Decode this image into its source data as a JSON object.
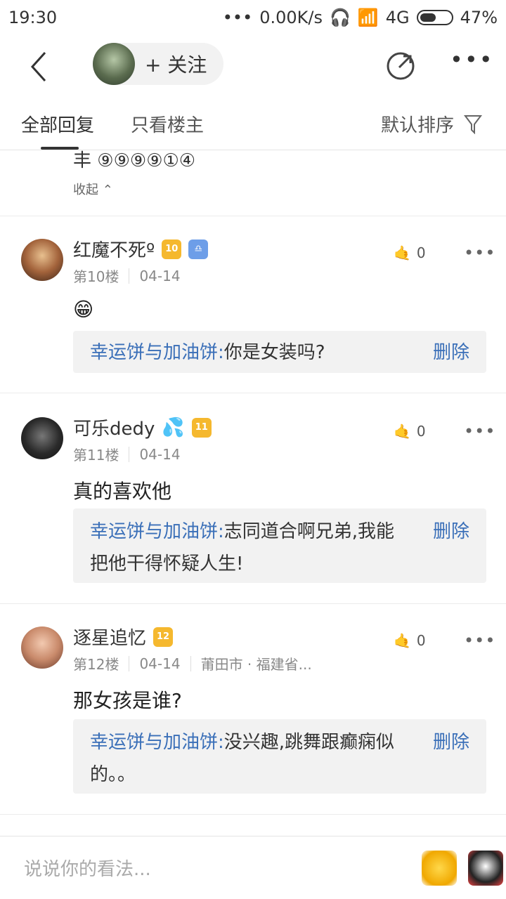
{
  "status": {
    "time": "19:30",
    "dots": "•••",
    "speed": "0.00K/s",
    "network": "4G",
    "battery": "47%"
  },
  "nav": {
    "follow_label": "+ 关注"
  },
  "tabs": {
    "active": "全部回复",
    "inactive": "只看楼主",
    "sort": "默认排序"
  },
  "partial": {
    "cut_text": "丰 ⑨⑨⑨⑨①④",
    "collapse": "收起 ⌃"
  },
  "posts": [
    {
      "name": "红魔不死º",
      "level": "10",
      "floor": "第10楼",
      "date": "04-14",
      "likes": "0",
      "content": "😁",
      "reply_user": "幸运饼与加油饼:",
      "reply_text": "你是女装吗?",
      "delete": "删除"
    },
    {
      "name": "可乐dedy",
      "level": "11",
      "floor": "第11楼",
      "date": "04-14",
      "likes": "0",
      "content": "真的喜欢他",
      "reply_user": "幸运饼与加油饼:",
      "reply_text": "志同道合啊兄弟,我能把他干得怀疑人生!",
      "delete": "删除"
    },
    {
      "name": "逐星追忆",
      "level": "12",
      "floor": "第12楼",
      "date": "04-14",
      "location": "莆田市 · 福建省...",
      "likes": "0",
      "content": "那女孩是谁?",
      "reply_user": "幸运饼与加油饼:",
      "reply_text": "没兴趣,跳舞跟癫痫似的。。",
      "delete": "删除"
    }
  ],
  "bottom": {
    "placeholder": "说说你的看法..."
  }
}
